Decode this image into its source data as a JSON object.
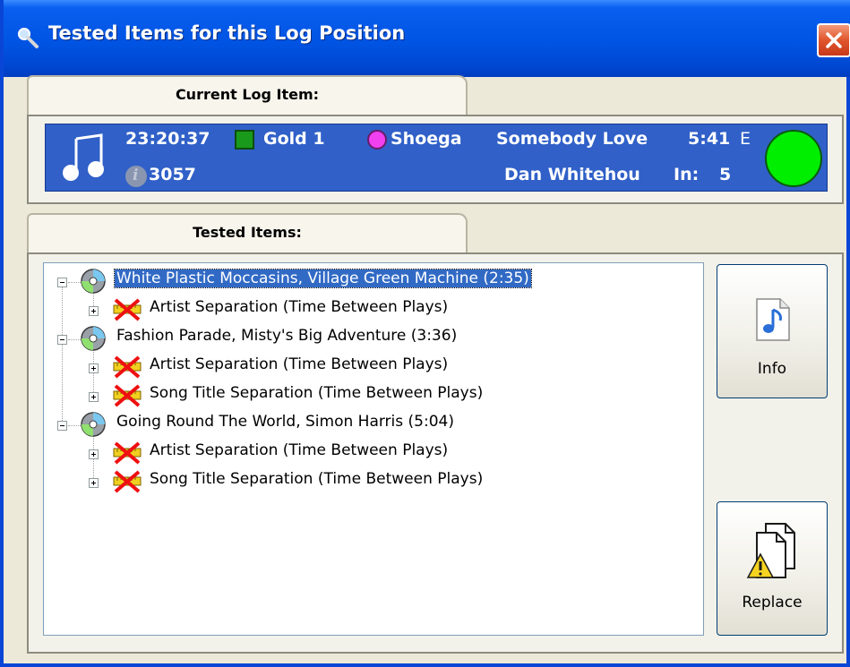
{
  "window": {
    "title": "Tested Items for this Log Position"
  },
  "current_log": {
    "tab_label": "Current Log Item:",
    "time": "23:20:37",
    "category": "Gold 1",
    "artist_short": "Shoega",
    "song": "Somebody Love",
    "length": "5:41",
    "end_flag": "E",
    "id": "3057",
    "artist_line2": "Dan Whitehou",
    "in_label": "In:",
    "in_value": "5",
    "category_color": "#1a9a1a",
    "mood_color": "#f040f0",
    "status_color": "#00ee00"
  },
  "tested": {
    "tab_label": "Tested Items:",
    "songs": [
      {
        "label": "White Plastic Moccasins, Village Green Machine (2:35)",
        "selected": true,
        "children": [
          "Artist Separation (Time Between Plays)"
        ]
      },
      {
        "label": "Fashion Parade, Misty's Big Adventure (3:36)",
        "selected": false,
        "children": [
          "Artist Separation (Time Between Plays)",
          "Song Title Separation (Time Between Plays)"
        ]
      },
      {
        "label": "Going Round The World, Simon Harris (5:04)",
        "selected": false,
        "children": [
          "Artist Separation (Time Between Plays)",
          "Song Title Separation (Time Between Plays)"
        ]
      }
    ]
  },
  "buttons": {
    "info_label": "Info",
    "replace_label": "Replace"
  },
  "icons": {
    "title": "magnifier-icon",
    "close": "close-icon",
    "log_type": "music-note-icon",
    "song": "cd-icon",
    "rule": "rule-violation-icon",
    "info": "music-file-icon",
    "replace": "replace-warning-icon"
  }
}
